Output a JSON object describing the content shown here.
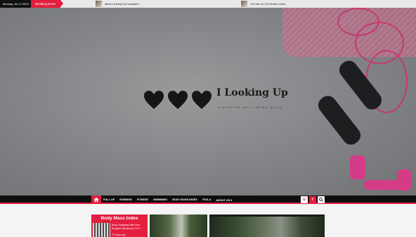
{
  "topbar": {
    "date": "Monday, Jul 17 2023",
    "breaking_label": "Breaking News",
    "ticker": [
      {
        "title": "What is A Body Fat Calculator?"
      },
      {
        "title": "The War On The Worlds Center"
      }
    ]
  },
  "header": {
    "site_title": "I Looking Up",
    "tagline": "ELEVATING WELL BEING DAILY"
  },
  "nav": {
    "home_icon": "home-icon",
    "items": [
      {
        "label": "PULL UP"
      },
      {
        "label": "RUNNING"
      },
      {
        "label": "FITNESS"
      },
      {
        "label": "SWIMMING"
      },
      {
        "label": "BODY MASS INDEX"
      },
      {
        "label": "TEXLA"
      },
      {
        "label": "ABOUT US"
      }
    ],
    "icons": [
      "G",
      "f",
      "Q"
    ]
  },
  "content": {
    "widget_title": "Body Mass Index",
    "widget_post_title": "Body Sculpting With Non Surgical Ultrasound, FoC...",
    "widget_post_date": "© 3 days ago"
  },
  "colors": {
    "accent": "#e41e3f",
    "nav_bg": "#0e0e0e"
  }
}
